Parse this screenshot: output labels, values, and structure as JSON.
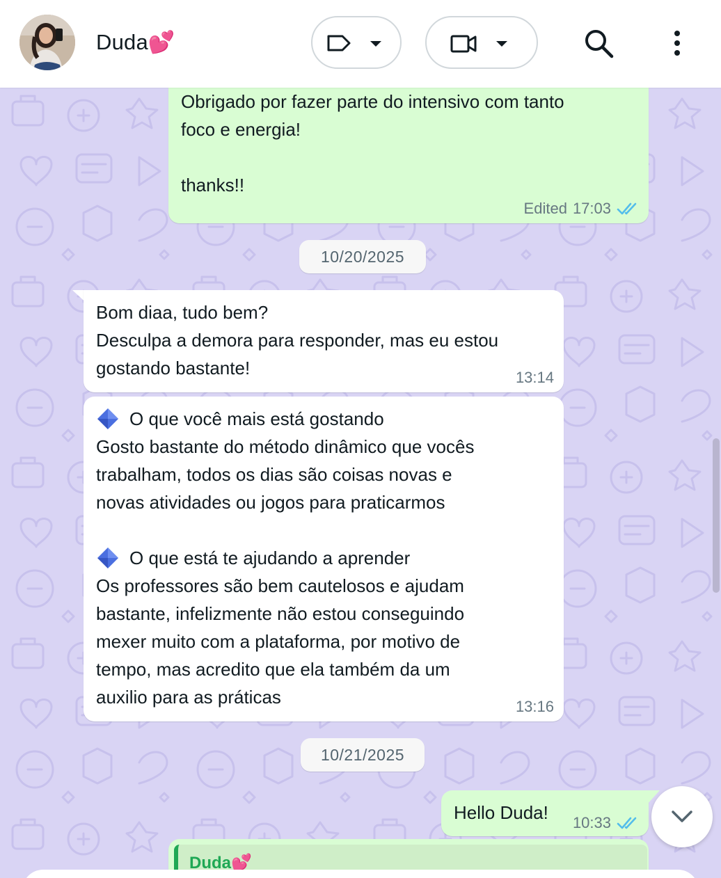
{
  "header": {
    "contact_name": "Duda💕",
    "search_icon": "search-icon",
    "menu_icon": "kebab-menu-icon"
  },
  "messages": {
    "m1": {
      "text": "Obrigado por fazer parte do intensivo com tanto\nfoco e energia!\n\nthanks!!",
      "status": "Edited",
      "time": "17:03"
    },
    "date1": "10/20/2025",
    "m2": {
      "text": "Bom diaa, tudo bem?\nDesculpa a demora para responder, mas eu estou\ngostando bastante!",
      "time": "13:14"
    },
    "m3": {
      "q1": "O que você mais está gostando",
      "a1": "Gosto bastante do método dinâmico que vocês\ntrabalham, todos os dias são coisas novas e\nnovas atividades ou jogos para praticarmos",
      "q2": "O que está te ajudando a aprender",
      "a2": "Os professores são bem cautelosos e ajudam\nbastante, infelizmente não estou conseguindo\nmexer muito com a plataforma, por motivo de\ntempo, mas acredito que ela também da um\nauxilio para as práticas",
      "time": "13:16"
    },
    "date2": "10/21/2025",
    "m4": {
      "text": "Hello Duda!",
      "time": "10:33"
    },
    "m5": {
      "quoted_name": "Duda💕"
    }
  },
  "colors": {
    "outgoing_bubble": "#d9fdd3",
    "incoming_bubble": "#ffffff",
    "wallpaper": "#d9d4f4",
    "read_ticks": "#53bdeb",
    "quoted_name": "#1fa855"
  }
}
